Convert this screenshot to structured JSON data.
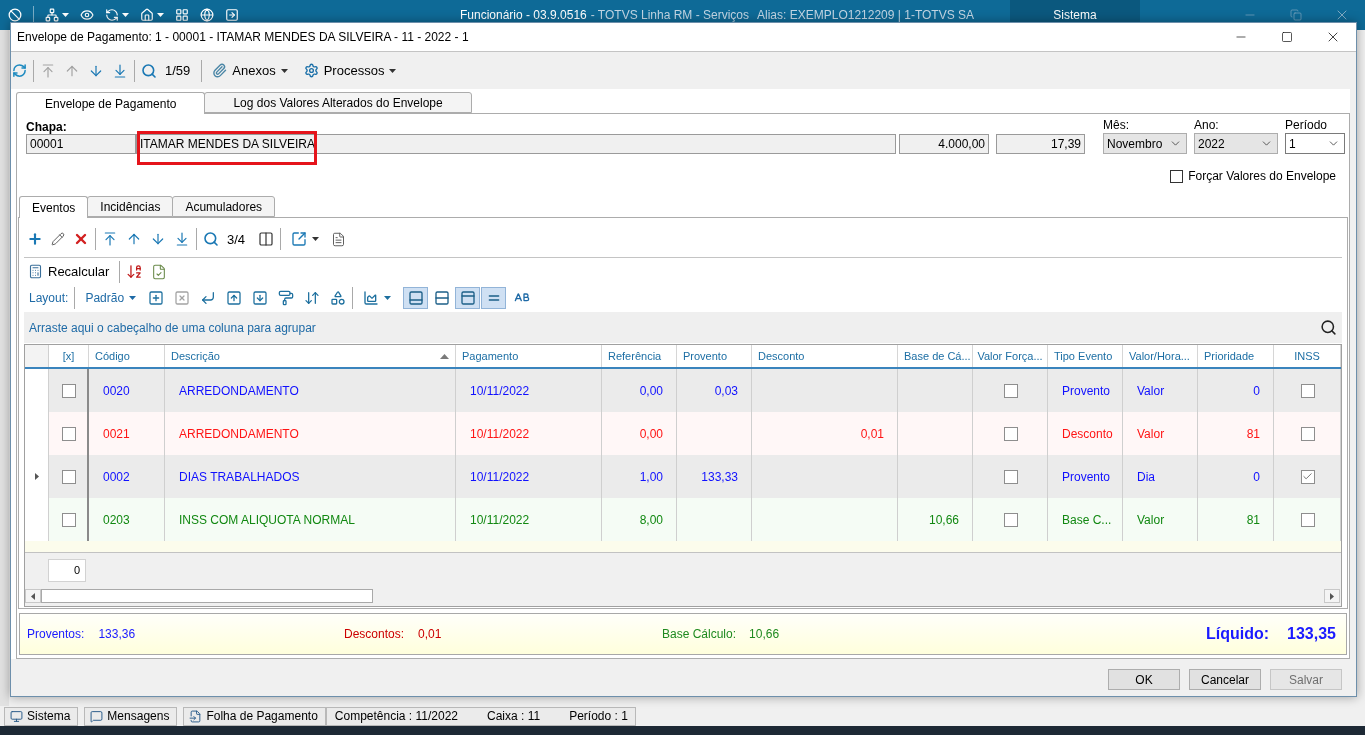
{
  "app_bar": {
    "title": "Funcionário - 03.9.0516",
    "product": "- TOTVS Linha RM - Serviços",
    "alias": "Alias: EXEMPLO1212209 | 1-TOTVS SA",
    "tab": "Sistema"
  },
  "dialog": {
    "title": "Envelope de Pagamento: 1 - 00001 - ITAMAR MENDES DA SILVEIRA - 11 - 2022 - 1"
  },
  "toolbar": {
    "nav": [
      {
        "kind": "first",
        "disabled": true
      },
      {
        "kind": "previous",
        "disabled": true
      },
      {
        "kind": "next",
        "disabled": false
      },
      {
        "kind": "last",
        "disabled": false
      }
    ],
    "counter": "1/59",
    "menus": [
      {
        "kind": "attachments",
        "label": "Anexos"
      },
      {
        "kind": "processes",
        "label": "Processos"
      }
    ]
  },
  "tabs": [
    {
      "label": "Envelope de Pagamento",
      "selected": true
    },
    {
      "label": "Log dos Valores Alterados do Envelope",
      "selected": false
    }
  ],
  "employee": {
    "label": "Chapa:",
    "code": "00001",
    "name": "ITAMAR MENDES DA SILVEIRA",
    "name_highlighted": true,
    "amount_1": "4.000,00",
    "amount_2": "17,39"
  },
  "period": [
    {
      "label": "Mês:",
      "value": "Novembro",
      "disabled": true
    },
    {
      "label": "Ano:",
      "value": "2022",
      "disabled": true
    },
    {
      "label": "Período",
      "value": "1",
      "disabled": false
    }
  ],
  "force_values": {
    "label": "Forçar Valores do Envelope",
    "checked": false
  },
  "inner_tabs": [
    {
      "label": "Eventos",
      "selected": true
    },
    {
      "label": "Incidências",
      "selected": false
    },
    {
      "label": "Acumuladores",
      "selected": false
    }
  ],
  "events_toolbar": {
    "counter": "3/4"
  },
  "actions": {
    "recalculate": "Recalcular"
  },
  "layout_bar": {
    "label": "Layout:",
    "preset": "Padrão",
    "tools": [
      {
        "kind": "insert",
        "disabled": false
      },
      {
        "kind": "delete",
        "disabled": true
      },
      {
        "kind": "wrap",
        "disabled": false
      },
      {
        "kind": "move_up",
        "disabled": false
      },
      {
        "kind": "move_down",
        "disabled": false
      },
      {
        "kind": "paint",
        "disabled": false
      },
      {
        "kind": "clear",
        "disabled": false
      },
      {
        "kind": "shapes",
        "disabled": false
      }
    ],
    "toggles": [
      {
        "kind": "footer",
        "pressed": true
      },
      {
        "kind": "lines",
        "pressed": false
      },
      {
        "kind": "header",
        "pressed": true
      },
      {
        "kind": "bands",
        "pressed": true
      }
    ]
  },
  "group_panel": {
    "hint": "Arraste aqui o cabeçalho de uma coluna para agrupar"
  },
  "grid": {
    "columns": [
      {
        "label": "[x]",
        "kind": "check",
        "sorted": false
      },
      {
        "label": "Código",
        "kind": "text",
        "sorted": false
      },
      {
        "label": "Descrição",
        "kind": "text",
        "sorted": true
      },
      {
        "label": "Pagamento",
        "kind": "text",
        "sorted": false
      },
      {
        "label": "Referência",
        "kind": "number",
        "sorted": false
      },
      {
        "label": "Provento",
        "kind": "number",
        "sorted": false
      },
      {
        "label": "Desconto",
        "kind": "number",
        "sorted": false
      },
      {
        "label": "Base de Cá...",
        "kind": "number",
        "sorted": false
      },
      {
        "label": "Valor Força...",
        "kind": "check",
        "sorted": false
      },
      {
        "label": "Tipo Evento",
        "kind": "text",
        "sorted": false
      },
      {
        "label": "Valor/Hora...",
        "kind": "text",
        "sorted": false
      },
      {
        "label": "Prioridade",
        "kind": "number",
        "sorted": false
      },
      {
        "label": "INSS",
        "kind": "check",
        "sorted": false
      }
    ],
    "rows": [
      {
        "kind": "provento",
        "selected": false,
        "cells": [
          {
            "checked": false
          },
          {
            "text": "0020"
          },
          {
            "text": "ARREDONDAMENTO"
          },
          {
            "text": "10/11/2022"
          },
          {
            "text": "0,00"
          },
          {
            "text": "0,03"
          },
          {},
          {},
          {
            "checked": false
          },
          {
            "text": "Provento"
          },
          {
            "text": "Valor"
          },
          {
            "text": "0"
          },
          {
            "checked": false
          }
        ]
      },
      {
        "kind": "desconto",
        "selected": false,
        "cells": [
          {
            "checked": false
          },
          {
            "text": "0021"
          },
          {
            "text": "ARREDONDAMENTO"
          },
          {
            "text": "10/11/2022"
          },
          {
            "text": "0,00"
          },
          {},
          {
            "text": "0,01"
          },
          {},
          {
            "checked": false
          },
          {
            "text": "Desconto"
          },
          {
            "text": "Valor"
          },
          {
            "text": "81"
          },
          {
            "checked": false
          }
        ]
      },
      {
        "kind": "provento",
        "selected": true,
        "cells": [
          {
            "checked": false
          },
          {
            "text": "0002"
          },
          {
            "text": "DIAS TRABALHADOS"
          },
          {
            "text": "10/11/2022"
          },
          {
            "text": "1,00"
          },
          {
            "text": "133,33"
          },
          {},
          {},
          {
            "checked": false
          },
          {
            "text": "Provento"
          },
          {
            "text": "Dia"
          },
          {
            "text": "0"
          },
          {
            "checked": true
          }
        ]
      },
      {
        "kind": "base",
        "selected": false,
        "cells": [
          {
            "checked": false
          },
          {
            "text": "0203"
          },
          {
            "text": "INSS COM ALIQUOTA NORMAL"
          },
          {
            "text": "10/11/2022"
          },
          {
            "text": "8,00"
          },
          {},
          {},
          {
            "text": "10,66"
          },
          {
            "checked": false
          },
          {
            "text": "Base C..."
          },
          {
            "text": "Valor"
          },
          {
            "text": "81"
          },
          {
            "checked": false
          }
        ]
      }
    ],
    "footer_value": "0"
  },
  "totals": [
    {
      "kind": "proventos",
      "label": "Proventos:",
      "value": "133,36"
    },
    {
      "kind": "descontos",
      "label": "Descontos:",
      "value": "0,01"
    },
    {
      "kind": "base",
      "label": "Base Cálculo:",
      "value": "10,66"
    },
    {
      "kind": "liquido",
      "label": "Líquido:",
      "value": "133,35"
    }
  ],
  "buttons": [
    {
      "label": "OK",
      "disabled": false
    },
    {
      "label": "Cancelar",
      "disabled": false
    },
    {
      "label": "Salvar",
      "disabled": true
    }
  ],
  "status_bar": {
    "tabs": [
      {
        "kind": "system",
        "label": "Sistema"
      },
      {
        "kind": "messages",
        "label": "Mensagens"
      },
      {
        "kind": "payroll",
        "label": "Folha de Pagamento"
      }
    ],
    "info": [
      "Competência : 11/2022",
      "Caixa : 11",
      "Período : 1"
    ]
  }
}
